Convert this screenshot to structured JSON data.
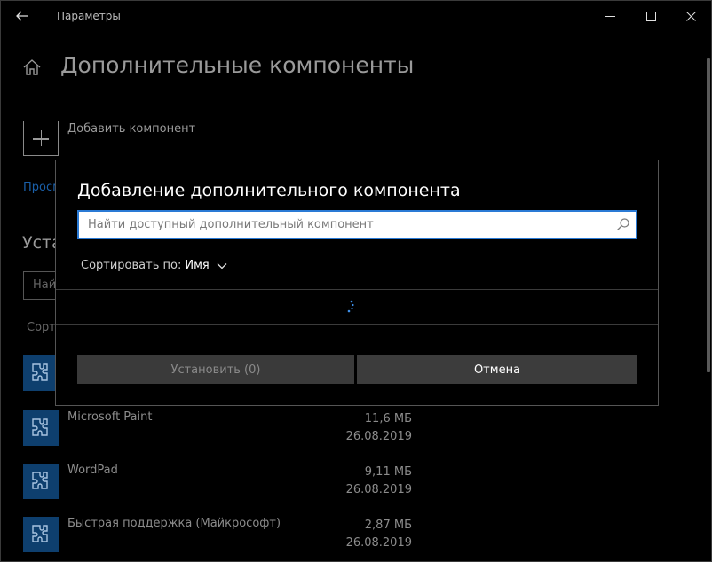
{
  "window": {
    "title": "Параметры",
    "controls": {
      "minimize": "minimize-icon",
      "maximize": "maximize-icon",
      "close": "close-icon"
    }
  },
  "page": {
    "title": "Дополнительные компоненты",
    "add_component_label": "Добавить компонент",
    "partial_link": "Просм",
    "partial_heading": "Уста",
    "partial_search_placeholder": "Най",
    "partial_sort": "Сорт"
  },
  "apps": [
    {
      "name": "Microsoft Paint",
      "size": "11,6 МБ",
      "date": "26.08.2019"
    },
    {
      "name": "WordPad",
      "size": "9,11 МБ",
      "date": "26.08.2019"
    },
    {
      "name": "Быстрая поддержка (Майкрософт)",
      "size": "2,87 МБ",
      "date": "26.08.2019"
    }
  ],
  "dialog": {
    "title": "Добавление дополнительного компонента",
    "search_placeholder": "Найти доступный дополнительный компонент",
    "search_value": "",
    "sort_label": "Сортировать по:",
    "sort_value": "Имя",
    "install_label": "Установить (0)",
    "cancel_label": "Отмена"
  },
  "colors": {
    "accent": "#2a7ad5",
    "app_icon_bg": "#0e3f6e",
    "link": "#1a5fa8",
    "background": "#000000"
  }
}
